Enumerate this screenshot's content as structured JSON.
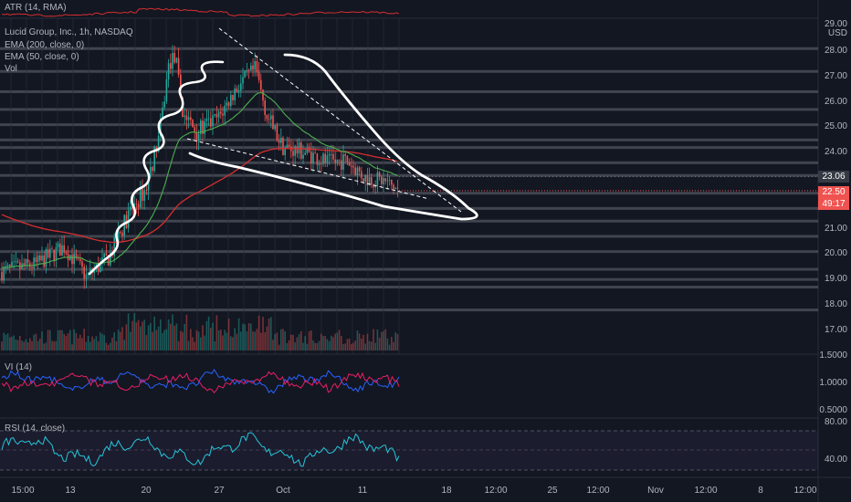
{
  "header": {
    "atr_label": "ATR (14, RMA)",
    "title": "Lucid Group, Inc., 1h, NASDAQ",
    "ema200": "EMA (200, close, 0)",
    "ema50": "EMA (50, close, 0)",
    "vol": "Vol",
    "currency": "USD",
    "top_price_partial": "29.00"
  },
  "price_tags": {
    "ema_value": "23.06",
    "last_price": "22.50",
    "countdown": "49:17"
  },
  "panes": {
    "vi_label": "VI (14)",
    "rsi_label": "RSI (14, close)",
    "atr_tick": "1.5000",
    "vi_ticks": [
      "1.0000",
      "0.5000"
    ],
    "rsi_ticks": [
      "80.00",
      "40.00"
    ]
  },
  "colors": {
    "background": "#131722",
    "up": "#26a69a",
    "down": "#ef5350",
    "ema200": "#d32f2f",
    "ema50": "#4caf50",
    "vi_plus": "#2962ff",
    "vi_minus": "#e91e63",
    "rsi": "#26c6da",
    "drawing": "#ffffff",
    "tag_ema": "#363a45",
    "tag_price": "#ef5350"
  },
  "chart_data": {
    "type": "candlestick",
    "price_ticks": [
      28,
      27,
      26,
      25,
      24,
      23,
      22,
      21,
      20,
      19,
      18,
      17
    ],
    "price_tick_labels": [
      "28.00",
      "27.00",
      "26.00",
      "25.00",
      "24.00",
      "23.00",
      "22.00",
      "21.00",
      "20.00",
      "19.00",
      "18.00",
      "17.00"
    ],
    "ylim": [
      16.3,
      29.2
    ],
    "x_labels": [
      "15:00",
      "13",
      "20",
      "27",
      "Oct",
      "11",
      "18",
      "12:00",
      "25",
      "12:00",
      "Nov",
      "12:00",
      "8",
      "12:00"
    ],
    "last_price": 22.5,
    "ema_last": 23.06
  }
}
